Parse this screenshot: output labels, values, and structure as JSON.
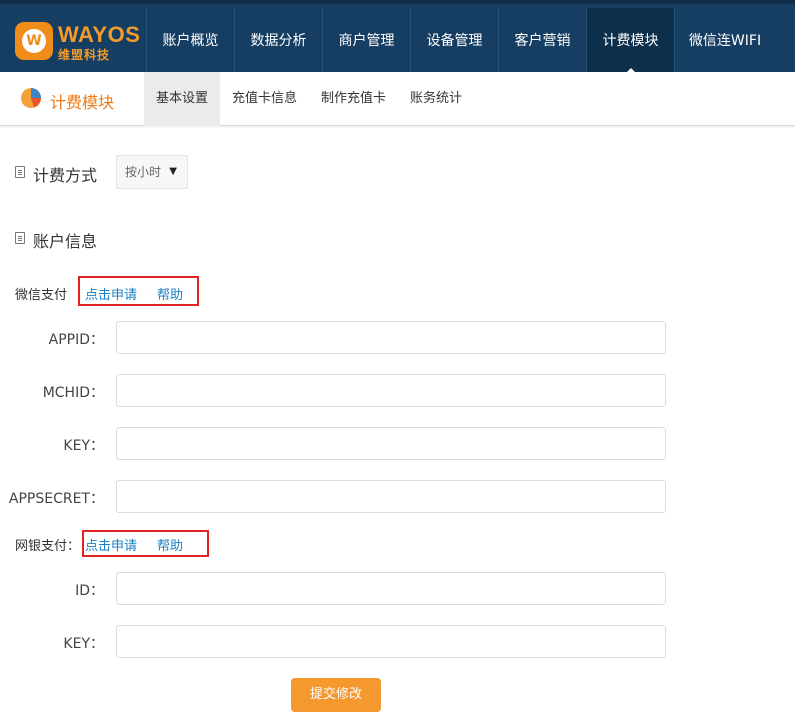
{
  "brand": {
    "name": "WAYOS",
    "subtitle": "维盟科技",
    "badge_letter": "W"
  },
  "nav": {
    "items": [
      {
        "label": "账户概览",
        "active": false
      },
      {
        "label": "数据分析",
        "active": false
      },
      {
        "label": "商户管理",
        "active": false
      },
      {
        "label": "设备管理",
        "active": false
      },
      {
        "label": "客户营销",
        "active": false
      },
      {
        "label": "计费模块",
        "active": true
      },
      {
        "label": "微信连WIFI",
        "active": false
      }
    ]
  },
  "module": {
    "title": "计费模块",
    "tabs": [
      {
        "label": "基本设置",
        "active": true
      },
      {
        "label": "充值卡信息",
        "active": false
      },
      {
        "label": "制作充值卡",
        "active": false
      },
      {
        "label": "账务统计",
        "active": false
      }
    ]
  },
  "billing": {
    "title": "计费方式",
    "selected": "按小时"
  },
  "account": {
    "title": "账户信息",
    "wechat": {
      "label": "微信支付",
      "apply_link": "点击申请",
      "help_link": "帮助",
      "fields": [
        {
          "label": "APPID：",
          "value": ""
        },
        {
          "label": "MCHID：",
          "value": ""
        },
        {
          "label": "KEY：",
          "value": ""
        },
        {
          "label": "APPSECRET：",
          "value": ""
        }
      ]
    },
    "bank": {
      "label": "网银支付：",
      "apply_link": "点击申请",
      "help_link": "帮助",
      "fields": [
        {
          "label": "ID：",
          "value": ""
        },
        {
          "label": "KEY：",
          "value": ""
        }
      ]
    }
  },
  "submit_label": "提交修改",
  "colors": {
    "topbar": "#163e62",
    "accent": "#f07a18",
    "link": "#1a7fc5",
    "highlight_box": "#e02424",
    "button": "#f5982e"
  }
}
